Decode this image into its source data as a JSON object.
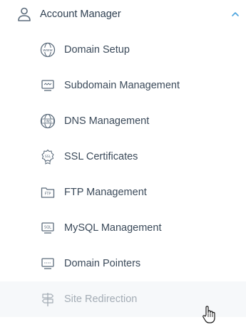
{
  "header": {
    "title": "Account Manager",
    "icon": "user-icon",
    "chevron_icon": "chevron-up-icon",
    "accent_color": "#4aa3df"
  },
  "menu": {
    "items": [
      {
        "label": "Domain Setup",
        "icon": "www-globe-icon",
        "icon_text": "www"
      },
      {
        "label": "Subdomain Management",
        "icon": "monitor-icon"
      },
      {
        "label": "DNS Management",
        "icon": "dns-globe-icon",
        "icon_text": "DNS"
      },
      {
        "label": "SSL Certificates",
        "icon": "ssl-badge-icon",
        "icon_text": "SSL"
      },
      {
        "label": "FTP Management",
        "icon": "ftp-folder-icon",
        "icon_text": "FTP"
      },
      {
        "label": "MySQL Management",
        "icon": "sql-monitor-icon",
        "icon_text": "SQL"
      },
      {
        "label": "Domain Pointers",
        "icon": "pointer-monitor-icon"
      },
      {
        "label": "Site Redirection",
        "icon": "signpost-icon",
        "active": true
      }
    ]
  },
  "cursor": {
    "icon": "hand-pointer-icon"
  }
}
